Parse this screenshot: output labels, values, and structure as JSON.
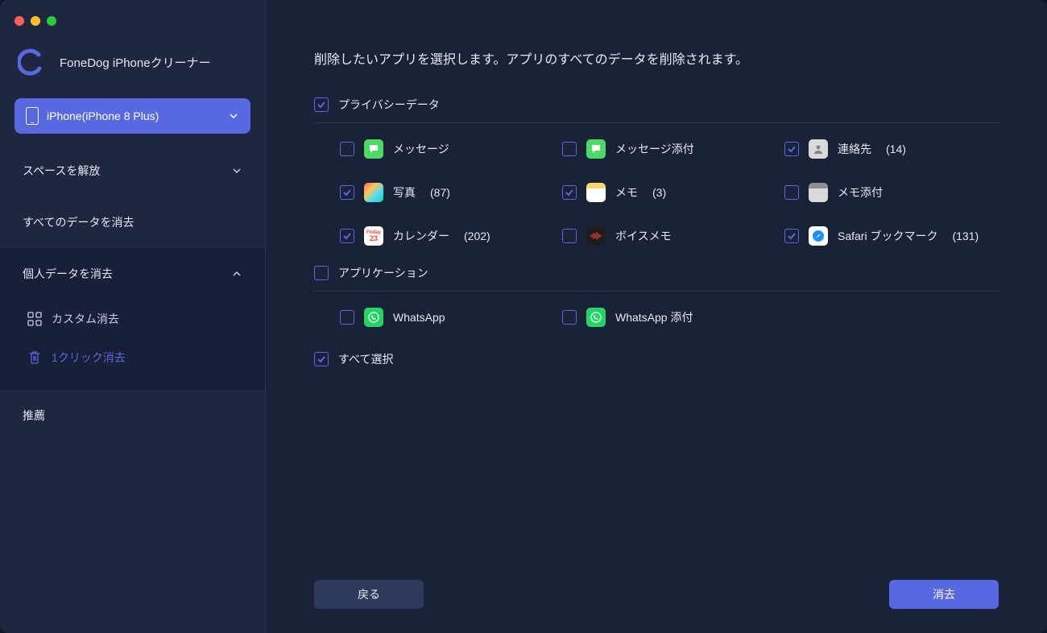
{
  "brand": {
    "title": "FoneDog iPhoneクリーナー"
  },
  "device": {
    "label": "iPhone(iPhone 8 Plus)"
  },
  "nav": {
    "free_space": "スペースを解放",
    "erase_all": "すべてのデータを消去",
    "erase_private": "個人データを消去",
    "custom_erase": "カスタム消去",
    "one_click_erase": "1クリック消去",
    "recommended": "推薦"
  },
  "main": {
    "heading": "削除したいアプリを選択します。アプリのすべてのデータを削除されます。",
    "section_privacy": "プライバシーデータ",
    "section_apps": "アプリケーション",
    "select_all": "すべて選択",
    "back": "戻る",
    "erase": "消去"
  },
  "privacy_items": {
    "messages": {
      "label": "メッセージ",
      "count": "",
      "checked": false,
      "icon": "ic-messages"
    },
    "msg_attach": {
      "label": "メッセージ添付",
      "count": "",
      "checked": false,
      "icon": "ic-messages"
    },
    "contacts": {
      "label": "連絡先",
      "count": "(14)",
      "checked": true,
      "icon": "ic-contacts"
    },
    "photos": {
      "label": "写真",
      "count": "(87)",
      "checked": true,
      "icon": "ic-photos"
    },
    "notes": {
      "label": "メモ",
      "count": "(3)",
      "checked": true,
      "icon": "ic-notes"
    },
    "notes_attach": {
      "label": "メモ添付",
      "count": "",
      "checked": false,
      "icon": "ic-notesatt"
    },
    "calendar": {
      "label": "カレンダー",
      "count": "(202)",
      "checked": true,
      "icon": "ic-calendar"
    },
    "voice": {
      "label": "ボイスメモ",
      "count": "",
      "checked": false,
      "icon": "ic-voice"
    },
    "safari": {
      "label": "Safari ブックマーク",
      "count": "(131)",
      "checked": true,
      "icon": "ic-safari"
    }
  },
  "app_items": {
    "whatsapp": {
      "label": "WhatsApp",
      "count": "",
      "checked": false,
      "icon": "ic-whatsapp"
    },
    "whatsapp_att": {
      "label": "WhatsApp 添付",
      "count": "",
      "checked": false,
      "icon": "ic-whatsapp"
    }
  },
  "section_checks": {
    "privacy": true,
    "apps": false,
    "select_all": true
  }
}
